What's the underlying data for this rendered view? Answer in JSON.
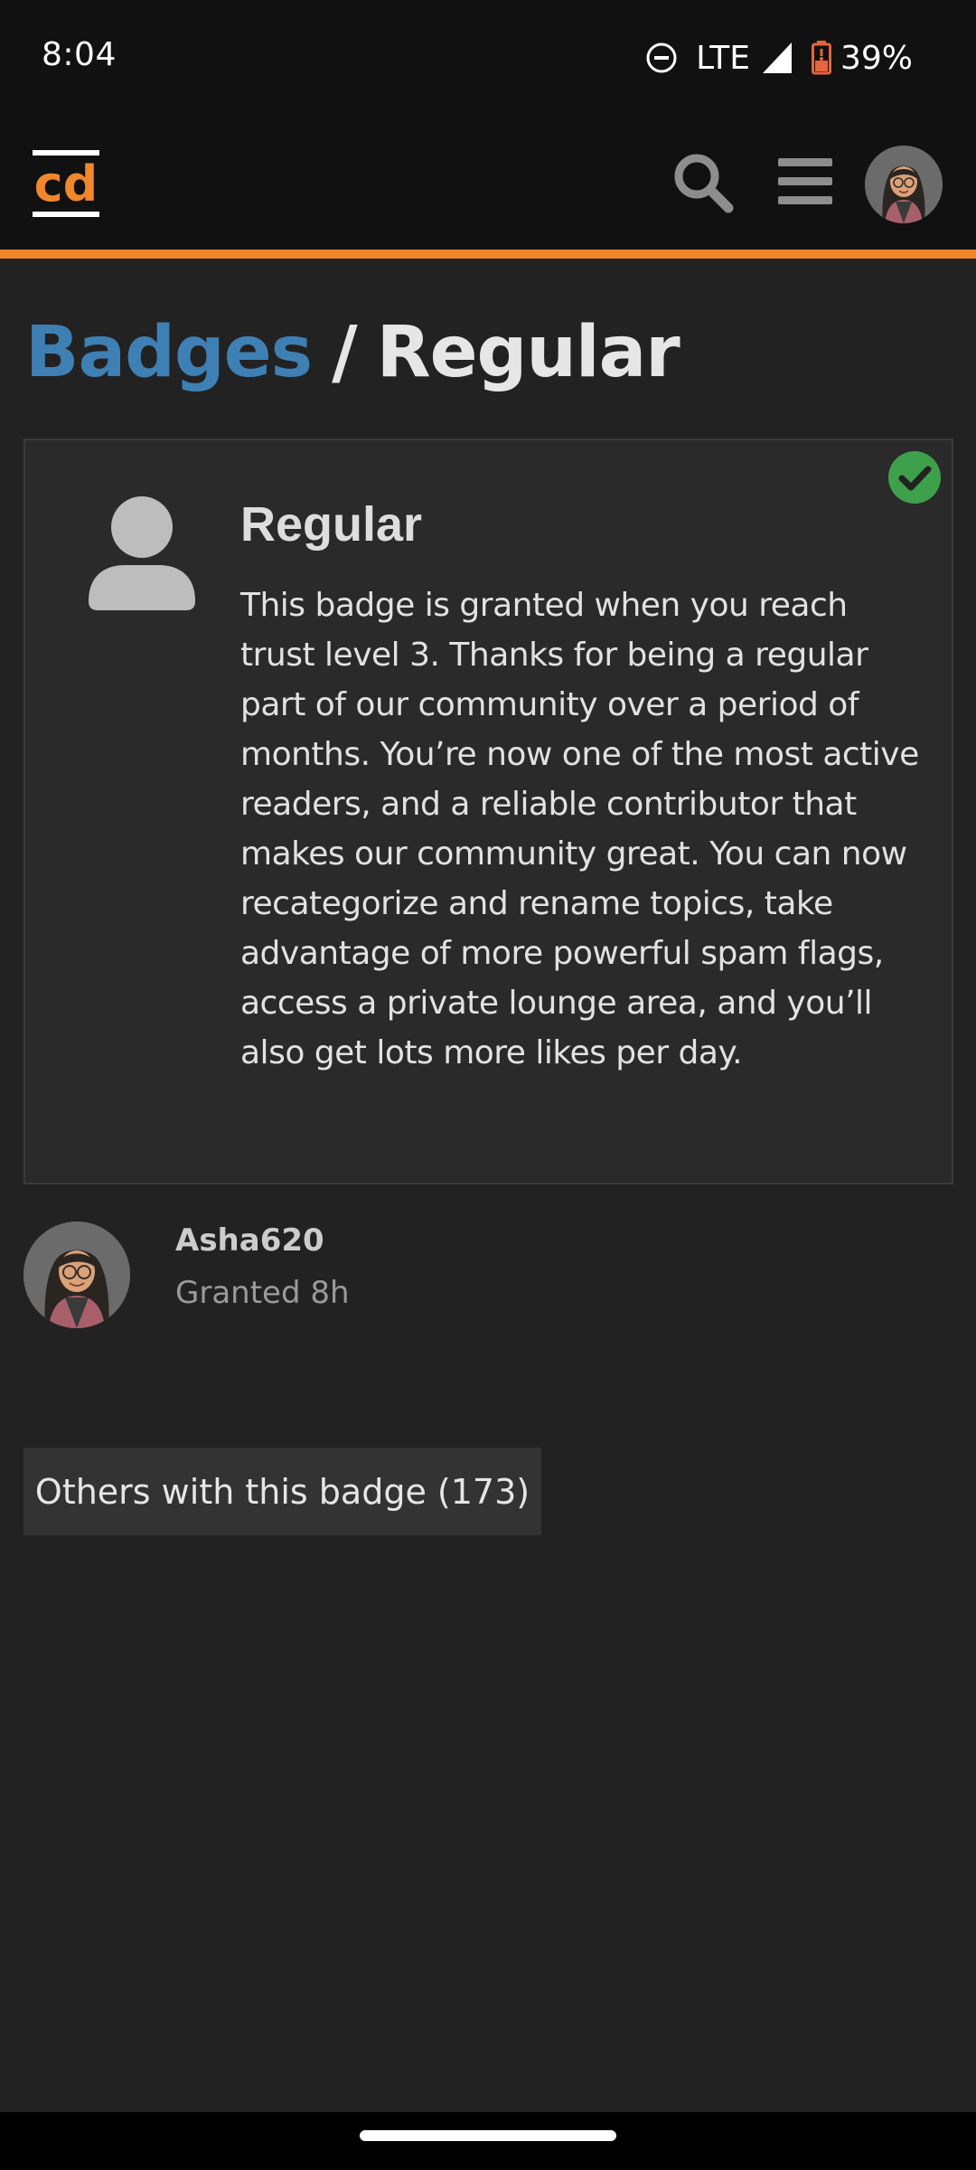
{
  "status_bar": {
    "time": "8:04",
    "network": "LTE",
    "battery": "39%",
    "icons": [
      "do-not-disturb-icon",
      "signal-icon",
      "battery-icon"
    ]
  },
  "header": {
    "logo_text": "cd",
    "accent_color": "#f0872b",
    "icons": [
      "search-icon",
      "hamburger-menu-icon",
      "user-avatar"
    ]
  },
  "breadcrumb": {
    "parent": "Badges",
    "separator": "/",
    "current": "Regular",
    "link_color": "#3e80b4"
  },
  "badge": {
    "name": "Regular",
    "icon": "user-icon",
    "status_icon": "check-circle-icon",
    "status_color": "#3fa04b",
    "description": "This badge is granted when you reach trust level 3. Thanks for being a regular part of our community over a period of months. You’re now one of the most active readers, and a reliable contributor that makes our community great. You can now recategorize and rename topics, take advantage of more powerful spam flags, access a private lounge area, and you’ll also get lots more likes per day."
  },
  "granted_user": {
    "username": "Asha620",
    "granted_text": "Granted 8h"
  },
  "others_button": {
    "label": "Others with this badge (173)"
  }
}
